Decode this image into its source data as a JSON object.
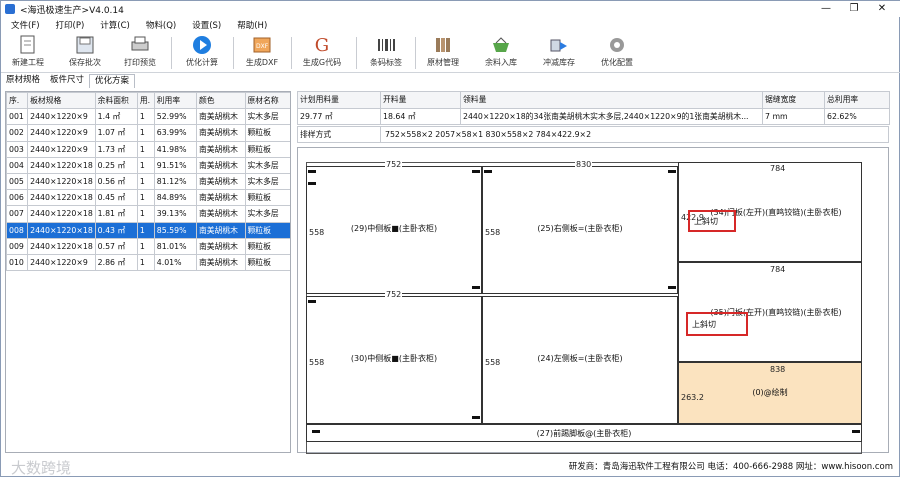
{
  "window": {
    "title": "<海迅极速生产>V4.0.14",
    "min": "—",
    "restore": "❐",
    "close": "✕"
  },
  "menu": [
    "文件(F)",
    "打印(P)",
    "计算(C)",
    "物料(Q)",
    "设置(S)",
    "帮助(H)"
  ],
  "toolbar": [
    {
      "label": "新建工程",
      "icon": "new-project-icon"
    },
    {
      "label": "保存批次",
      "icon": "save-icon"
    },
    {
      "label": "打印预览",
      "icon": "print-preview-icon"
    },
    {
      "label": "优化计算",
      "icon": "play-icon"
    },
    {
      "label": "生成DXF",
      "icon": "dxf-icon"
    },
    {
      "label": "生成G代码",
      "icon": "g-code-icon"
    },
    {
      "label": "条码标签",
      "icon": "barcode-icon"
    },
    {
      "label": "原材管理",
      "icon": "material-icon"
    },
    {
      "label": "余料入库",
      "icon": "basket-icon"
    },
    {
      "label": "冲减库存",
      "icon": "deduct-icon"
    },
    {
      "label": "优化配置",
      "icon": "gear-icon"
    }
  ],
  "tabs": [
    "原材规格",
    "板件尺寸",
    "优化方案"
  ],
  "left_table": {
    "headers": [
      "序.",
      "板材规格",
      "余料面积",
      "用.",
      "利用率",
      "颜色",
      "原材名称"
    ],
    "rows": [
      [
        "001",
        "2440×1220×9",
        "1.4 ㎡",
        "1",
        "52.99%",
        "南美胡桃木",
        "实木多层"
      ],
      [
        "002",
        "2440×1220×9",
        "1.07 ㎡",
        "1",
        "63.99%",
        "南美胡桃木",
        "颗粒板"
      ],
      [
        "003",
        "2440×1220×9",
        "1.73 ㎡",
        "1",
        "41.98%",
        "南美胡桃木",
        "颗粒板"
      ],
      [
        "004",
        "2440×1220×18",
        "0.25 ㎡",
        "1",
        "91.51%",
        "南美胡桃木",
        "实木多层"
      ],
      [
        "005",
        "2440×1220×18",
        "0.56 ㎡",
        "1",
        "81.12%",
        "南美胡桃木",
        "实木多层"
      ],
      [
        "006",
        "2440×1220×18",
        "0.45 ㎡",
        "1",
        "84.89%",
        "南美胡桃木",
        "颗粒板"
      ],
      [
        "007",
        "2440×1220×18",
        "1.81 ㎡",
        "1",
        "39.13%",
        "南美胡桃木",
        "实木多层"
      ],
      [
        "008",
        "2440×1220×18",
        "0.43 ㎡",
        "1",
        "85.59%",
        "南美胡桃木",
        "颗粒板"
      ],
      [
        "009",
        "2440×1220×18",
        "0.57 ㎡",
        "1",
        "81.01%",
        "南美胡桃木",
        "颗粒板"
      ],
      [
        "010",
        "2440×1220×9",
        "2.86 ㎡",
        "1",
        "4.01%",
        "南美胡桃木",
        "颗粒板"
      ]
    ],
    "selected_index": 7
  },
  "summary": {
    "headers": [
      "计划用料量",
      "开料量",
      "领料量",
      "锯缝宽度",
      "总利用率"
    ],
    "values": [
      "29.77 ㎡",
      "18.64 ㎡",
      "2440×1220×18的34张南美胡桃木实木多层,2440×1220×9的1张南美胡桃木...",
      "7 mm",
      "62.62%"
    ],
    "layout_label": "排样方式",
    "layout_value": "752×558×2 2057×58×1 830×558×2 784×422.9×2"
  },
  "diagram": {
    "pieces": [
      {
        "label": "(29)中侧板■(主卧衣柜)",
        "w": "752",
        "h": "558"
      },
      {
        "label": "(25)右侧板=(主卧衣柜)",
        "w": "830",
        "h": "558"
      },
      {
        "label": "(34)门板(左开)(直鸣铰链)(主卧衣柜)",
        "w": "784",
        "h": "422.9"
      },
      {
        "label": "(30)中侧板■(主卧衣柜)",
        "w": "752",
        "h": "558"
      },
      {
        "label": "(24)左侧板=(主卧衣柜)",
        "w": "830",
        "h": "558"
      },
      {
        "label": "(35)门板(左开)(直鸣铰链)(主卧衣柜)",
        "w": "784",
        "h": ""
      },
      {
        "label": "(0)@绘制",
        "w": "838",
        "h": "263.2"
      },
      {
        "label": "(27)前踢脚板@(主卧衣柜)",
        "w": "",
        "h": ""
      }
    ],
    "annotation": "上斜切"
  },
  "status": {
    "company": "研发商：青岛海迅软件工程有限公司  电话：400-666-2988  网址：www.hisoon.com",
    "watermark": "大数跨境"
  },
  "colors": {
    "selected_row": "#1c6fd6",
    "highlight_piece": "#fbe3bf",
    "red_box": "#d62828"
  }
}
